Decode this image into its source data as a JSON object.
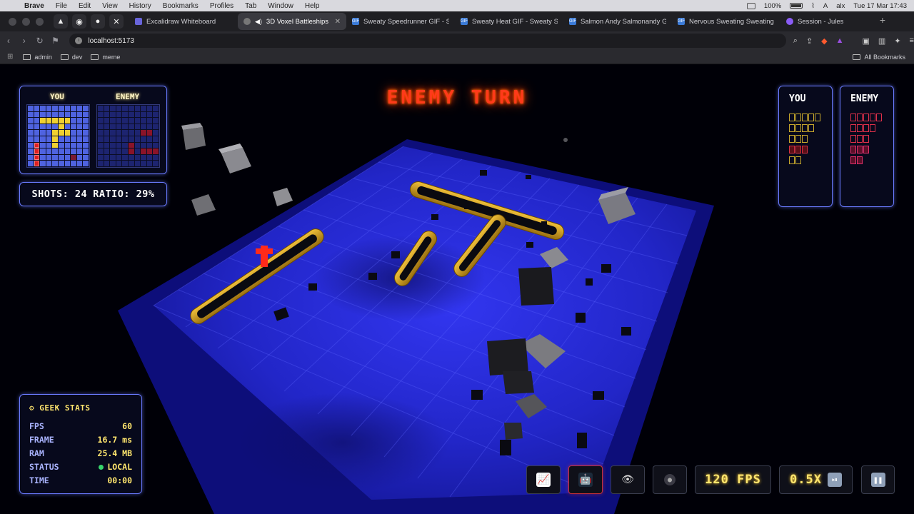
{
  "menubar": {
    "app": "Brave",
    "items": [
      "File",
      "Edit",
      "View",
      "History",
      "Bookmarks",
      "Profiles",
      "Tab",
      "Window",
      "Help"
    ],
    "battery": "100%",
    "user": "alx",
    "input": "A",
    "datetime": "Tue 17 Mar  17:43"
  },
  "tabs": [
    {
      "title": "Excalidraw Whiteboard",
      "active": false
    },
    {
      "title": "3D Voxel Battleships",
      "active": true
    },
    {
      "title": "Sweaty Speedrunner GIF - Swe",
      "active": false
    },
    {
      "title": "Sweaty Heat GIF - Sweaty Swe",
      "active": false
    },
    {
      "title": "Salmon Andy Salmonandy GIF -",
      "active": false
    },
    {
      "title": "Nervous Sweating Sweating Bu",
      "active": false
    },
    {
      "title": "Session - Jules",
      "active": false
    }
  ],
  "address": {
    "url": "localhost:5173"
  },
  "bookmarks": {
    "items": [
      "admin",
      "dev",
      "meme"
    ],
    "all": "All Bookmarks"
  },
  "game": {
    "turn_banner": "ENEMY TURN",
    "minimap": {
      "you_label": "YOU",
      "enemy_label": "ENEMY",
      "you_grid": [
        "wwwwwwwwww",
        "wwwwwwwwww",
        "wwyyyyywww",
        "wwwwwywwww",
        "wwwwyyywww",
        "wwwwywwwww",
        "wrwwywwwww",
        "wrwwwwwwww",
        "wrwwwwwkww",
        "wrwwwwwwww"
      ],
      "enemy_grid": [
        "dddddddddd",
        "dddddddddd",
        "dddddddddd",
        "dddddddddd",
        "dddddddhhd",
        "dddddddddd",
        "dddddhdddd",
        "dddddhdhhh",
        "dddddddddd",
        "dddddddddd"
      ]
    },
    "shots_label": "SHOTS: 24",
    "ratio_label": "RATIO: 29%",
    "fleet_you": {
      "title": "YOU",
      "ships": [
        {
          "size": 5,
          "state": "ok"
        },
        {
          "size": 4,
          "state": "ok"
        },
        {
          "size": 3,
          "state": "ok"
        },
        {
          "size": 3,
          "state": "sunk"
        },
        {
          "size": 2,
          "state": "ok"
        }
      ]
    },
    "fleet_enemy": {
      "title": "ENEMY",
      "ships": [
        {
          "size": 5,
          "state": "enemy"
        },
        {
          "size": 4,
          "state": "enemy"
        },
        {
          "size": 3,
          "state": "enemy"
        },
        {
          "size": 3,
          "state": "hit"
        },
        {
          "size": 2,
          "state": "hit"
        }
      ]
    },
    "geek_stats": {
      "title": "⚙ GEEK STATS",
      "rows": [
        {
          "key": "FPS",
          "value": "60"
        },
        {
          "key": "FRAME",
          "value": "16.7 ms"
        },
        {
          "key": "RAM",
          "value": "25.4 MB"
        },
        {
          "key": "STATUS",
          "value": "LOCAL"
        },
        {
          "key": "TIME",
          "value": "00:00"
        }
      ]
    },
    "controls": {
      "fps_cap": "120 FPS",
      "speed": "0.5X"
    }
  },
  "colors": {
    "water": "#2a2ee0",
    "ship": "#d8a521",
    "hit": "#e02020",
    "enemy_fleet": "#e0304a",
    "you_fleet": "#d4b23a",
    "turn_text": "#ff3a1a",
    "hud_border": "#6a7bff"
  }
}
